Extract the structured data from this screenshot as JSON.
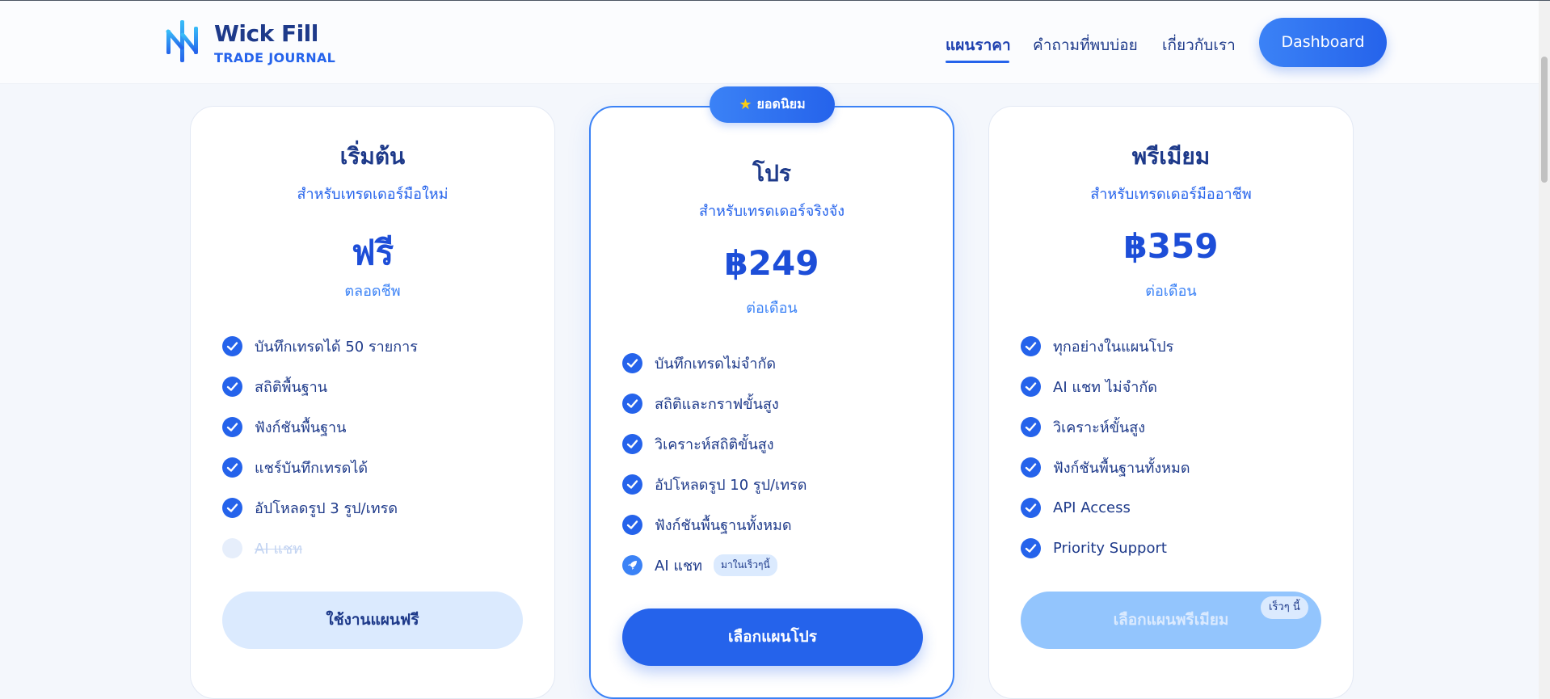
{
  "header": {
    "brand_name": "Wick Fill",
    "brand_sub": "TRADE JOURNAL",
    "nav": [
      {
        "label": "แผนราคา"
      },
      {
        "label": "คำถามที่พบบ่อย"
      },
      {
        "label": "เกี่ยวกับเรา"
      }
    ],
    "dashboard_label": "Dashboard"
  },
  "popular_badge": "ยอดนิยม",
  "plans": [
    {
      "title": "เริ่มต้น",
      "subtitle": "สำหรับเทรดเดอร์มือใหม่",
      "price": "ฟรี",
      "period": "ตลอดชีพ",
      "features": [
        "บันทึกเทรดได้ 50 รายการ",
        "สถิติพื้นฐาน",
        "ฟังก์ชันพื้นฐาน",
        "แชร์บันทึกเทรดได้",
        "อัปโหลดรูป 3 รูป/เทรด",
        "AI แชท"
      ],
      "button": "ใช้งานแผนฟรี"
    },
    {
      "title": "โปร",
      "subtitle": "สำหรับเทรดเดอร์จริงจัง",
      "price": "฿249",
      "period": "ต่อเดือน",
      "features": [
        "บันทึกเทรดไม่จำกัด",
        "สถิติและกราฟขั้นสูง",
        "วิเคราะห์สถิติขั้นสูง",
        "อัปโหลดรูป 10 รูป/เทรด",
        "ฟังก์ชันพื้นฐานทั้งหมด",
        "AI แชท"
      ],
      "coming_soon_pill": "มาในเร็วๆนี้",
      "button": "เลือกแผนโปร"
    },
    {
      "title": "พรีเมียม",
      "subtitle": "สำหรับเทรดเดอร์มืออาชีพ",
      "price": "฿359",
      "period": "ต่อเดือน",
      "features": [
        "ทุกอย่างในแผนโปร",
        "AI แชท ไม่จำกัด",
        "วิเคราะห์ขั้นสูง",
        "ฟังก์ชันพื้นฐานทั้งหมด",
        "API Access",
        "Priority Support"
      ],
      "button": "เลือกแผนพรีเมียม",
      "soon_tag": "เร็วๆ นี้"
    }
  ],
  "colors": {
    "primary": "#2563eb",
    "navy": "#1e3a8a",
    "light_blue": "#dbeafe",
    "background": "#f4f7fc"
  },
  "icons": [
    "wickfill-logo-icon",
    "star-icon",
    "check-icon",
    "rocket-icon"
  ]
}
